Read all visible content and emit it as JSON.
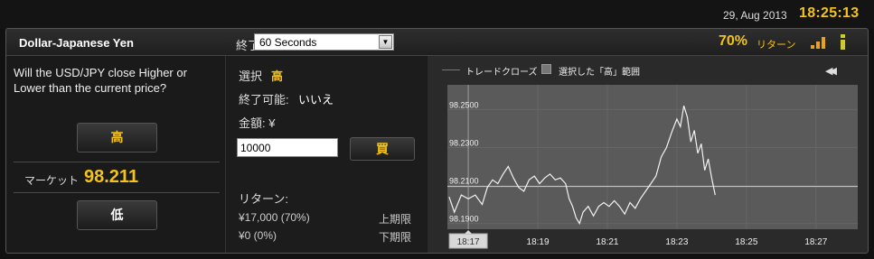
{
  "top": {
    "date": "29, Aug 2013",
    "time": "18:25:13"
  },
  "header": {
    "asset": "Dollar-Japanese Yen",
    "expiry_label": "終了",
    "expiry_value": "60 Seconds",
    "return_pct": "70%",
    "return_label": "リターン",
    "icons": [
      "signal-bars-icon",
      "info-icon"
    ],
    "accent_color": "#f3c31b"
  },
  "left": {
    "question": "Will the USD/JPY close Higher or Lower than the current price?",
    "high_button": "高",
    "market_label": "マーケット",
    "market_price": "98.211",
    "low_button": "低"
  },
  "middle": {
    "selection_label": "選択",
    "selection_value": "高",
    "closable_label": "終了可能:",
    "closable_value": "いいえ",
    "amount_label": "金額: ¥",
    "amount_value": "10000",
    "buy_button": "買",
    "return_title": "リターン:",
    "payout_high_value": "¥17,000 (70%)",
    "payout_high_label": "上期限",
    "payout_low_value": "¥0 (0%)",
    "payout_low_label": "下期限"
  },
  "chart_data": {
    "type": "line",
    "legend": [
      "トレードクローズ",
      "選択した「高」範囲"
    ],
    "y_ticks": [
      "98.2500",
      "98.2300",
      "98.2100",
      "98.1900"
    ],
    "x_ticks": [
      "18:17",
      "18:19",
      "18:21",
      "18:23",
      "18:25",
      "18:27"
    ],
    "ylim": [
      98.187,
      98.263
    ],
    "xlim": [
      16.4,
      28.2
    ],
    "strike": 98.2095,
    "current_marker": "18:17",
    "series": [
      {
        "values": [
          [
            16.45,
            98.204
          ],
          [
            16.6,
            98.196
          ],
          [
            16.8,
            98.205
          ],
          [
            17.0,
            98.203
          ],
          [
            17.2,
            98.205
          ],
          [
            17.4,
            98.2
          ],
          [
            17.55,
            98.209
          ],
          [
            17.7,
            98.213
          ],
          [
            17.85,
            98.211
          ],
          [
            18.0,
            98.216
          ],
          [
            18.15,
            98.22
          ],
          [
            18.3,
            98.214
          ],
          [
            18.45,
            98.209
          ],
          [
            18.6,
            98.207
          ],
          [
            18.75,
            98.213
          ],
          [
            18.9,
            98.215
          ],
          [
            19.05,
            98.211
          ],
          [
            19.2,
            98.214
          ],
          [
            19.35,
            98.216
          ],
          [
            19.5,
            98.213
          ],
          [
            19.65,
            98.214
          ],
          [
            19.8,
            98.211
          ],
          [
            19.9,
            98.203
          ],
          [
            20.0,
            98.199
          ],
          [
            20.1,
            98.193
          ],
          [
            20.2,
            98.19
          ],
          [
            20.3,
            98.196
          ],
          [
            20.45,
            98.199
          ],
          [
            20.6,
            98.194
          ],
          [
            20.75,
            98.199
          ],
          [
            20.9,
            98.201
          ],
          [
            21.05,
            98.199
          ],
          [
            21.2,
            98.202
          ],
          [
            21.35,
            98.199
          ],
          [
            21.5,
            98.195
          ],
          [
            21.65,
            98.201
          ],
          [
            21.8,
            98.198
          ],
          [
            21.95,
            98.203
          ],
          [
            22.1,
            98.207
          ],
          [
            22.25,
            98.211
          ],
          [
            22.4,
            98.215
          ],
          [
            22.55,
            98.225
          ],
          [
            22.7,
            98.23
          ],
          [
            22.85,
            98.238
          ],
          [
            23.0,
            98.245
          ],
          [
            23.1,
            98.241
          ],
          [
            23.2,
            98.252
          ],
          [
            23.3,
            98.246
          ],
          [
            23.4,
            98.233
          ],
          [
            23.5,
            98.239
          ],
          [
            23.6,
            98.227
          ],
          [
            23.7,
            98.232
          ],
          [
            23.8,
            98.218
          ],
          [
            23.9,
            98.224
          ],
          [
            24.0,
            98.214
          ],
          [
            24.1,
            98.205
          ]
        ]
      }
    ]
  }
}
